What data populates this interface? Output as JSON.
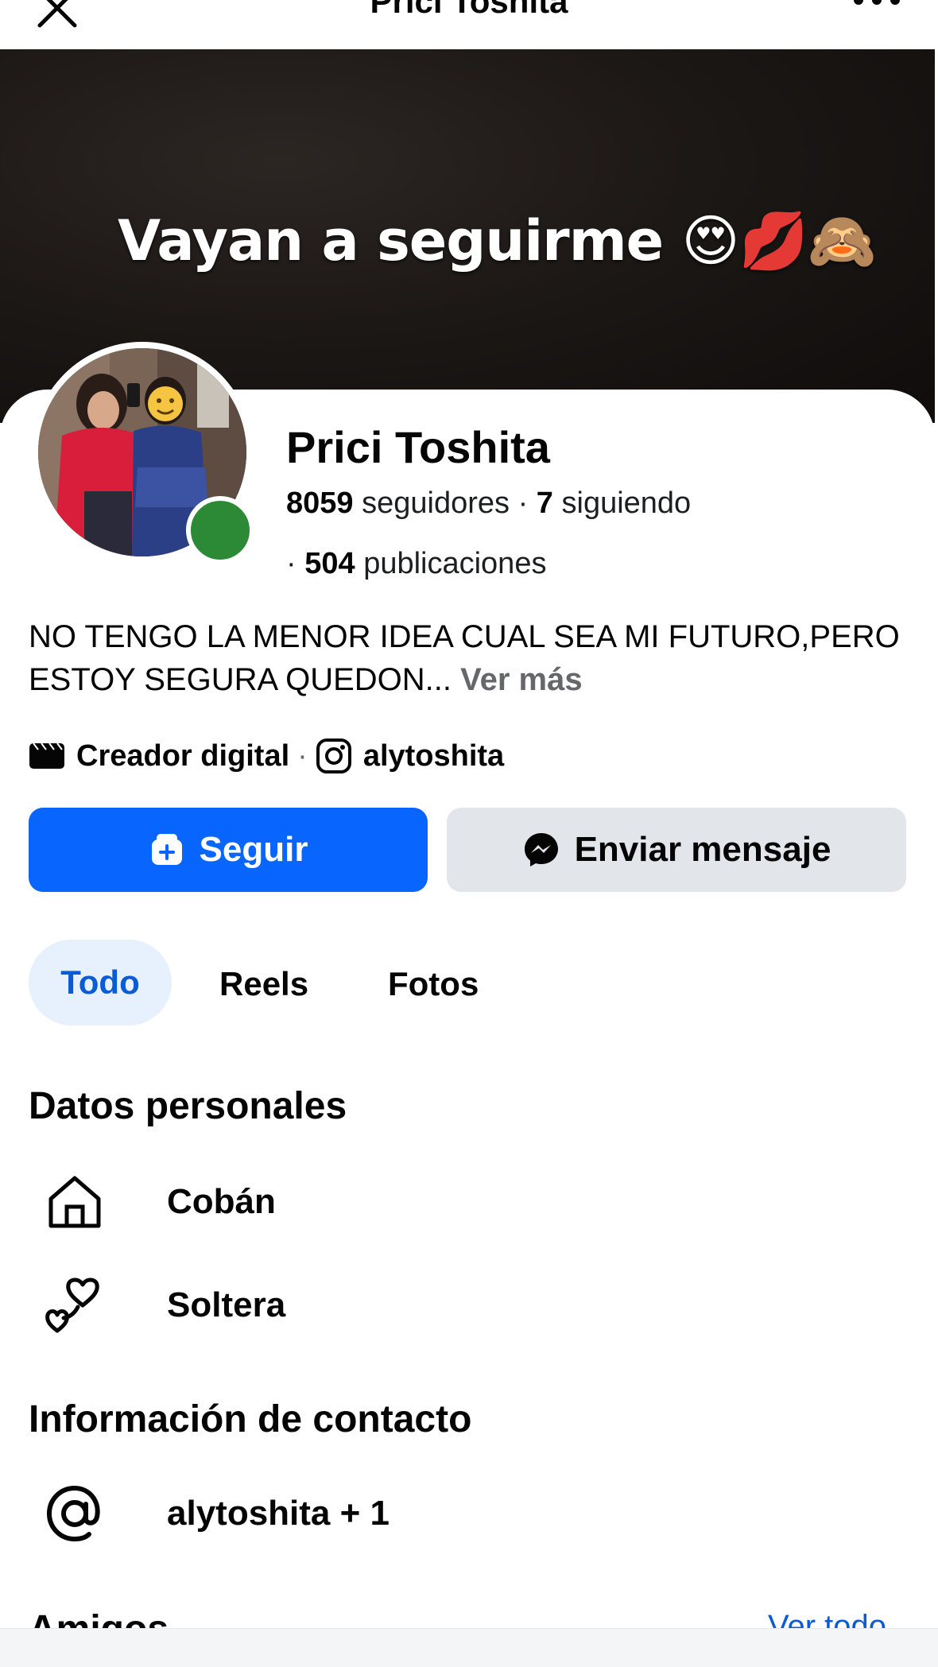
{
  "header": {
    "title": "Prici Toshita",
    "close_icon": "close-icon",
    "more_icon": "more-horizontal-icon"
  },
  "cover": {
    "text": "Vayan a seguirme 😍💋🙈"
  },
  "profile": {
    "name": "Prici Toshita",
    "followers_count": "8059",
    "followers_label": "seguidores",
    "following_count": "7",
    "following_label": "siguiendo",
    "posts_count": "504",
    "posts_label": "publicaciones",
    "online_color": "#2c8a36"
  },
  "bio": {
    "text": "NO TENGO LA MENOR IDEA CUAL SEA MI FUTURO,PERO ESTOY SEGURA QUEDON...",
    "more_label": "Ver más"
  },
  "category": {
    "label": "Creador digital",
    "instagram_handle": "alytoshita"
  },
  "actions": {
    "follow_label": "Seguir",
    "message_label": "Enviar mensaje",
    "follow_color": "#0866ff"
  },
  "tabs": [
    {
      "label": "Todo",
      "active": true
    },
    {
      "label": "Reels",
      "active": false
    },
    {
      "label": "Fotos",
      "active": false
    }
  ],
  "personal": {
    "title": "Datos personales",
    "city": "Cobán",
    "relationship": "Soltera"
  },
  "contact": {
    "title": "Información de contacto",
    "email": "alytoshita + 1"
  },
  "friends": {
    "title": "Amigos",
    "see_all": "Ver todo"
  }
}
